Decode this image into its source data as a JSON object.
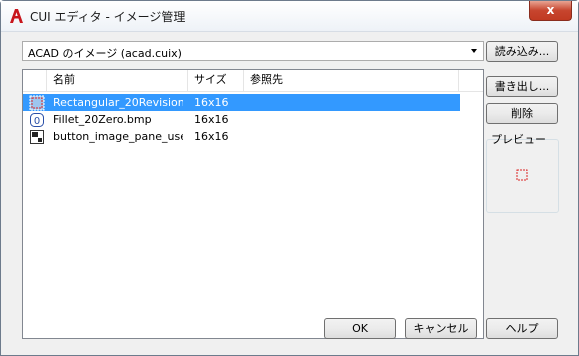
{
  "window": {
    "title": "CUI エディタ - イメージ管理",
    "close_glyph": "x"
  },
  "image_source": {
    "selected": "ACAD のイメージ (acad.cuix)"
  },
  "list": {
    "columns": [
      "名前",
      "サイズ",
      "参照先"
    ],
    "rows": [
      {
        "icon": "rectangle-revision-cloud-icon",
        "name": "Rectangular_20Revision...",
        "size": "16x16",
        "ref": "",
        "selected": true
      },
      {
        "icon": "fillet-zero-icon",
        "name": "Fillet_20Zero.bmp",
        "size": "16x16",
        "ref": "",
        "selected": false
      },
      {
        "icon": "button-pane-icon",
        "name": "button_image_pane_use_...",
        "size": "16x16",
        "ref": "",
        "selected": false
      }
    ]
  },
  "side_buttons": {
    "import": "読み込み...",
    "export": "書き出し...",
    "delete": "削除"
  },
  "preview": {
    "label": "プレビュー",
    "icon": "rectangle-revision-cloud-icon"
  },
  "footer": {
    "ok": "OK",
    "cancel": "キャンセル",
    "help": "ヘルプ"
  },
  "colors": {
    "selection": "#3399ff",
    "app_icon": "#c8161d",
    "close_button": "#c7452e"
  }
}
